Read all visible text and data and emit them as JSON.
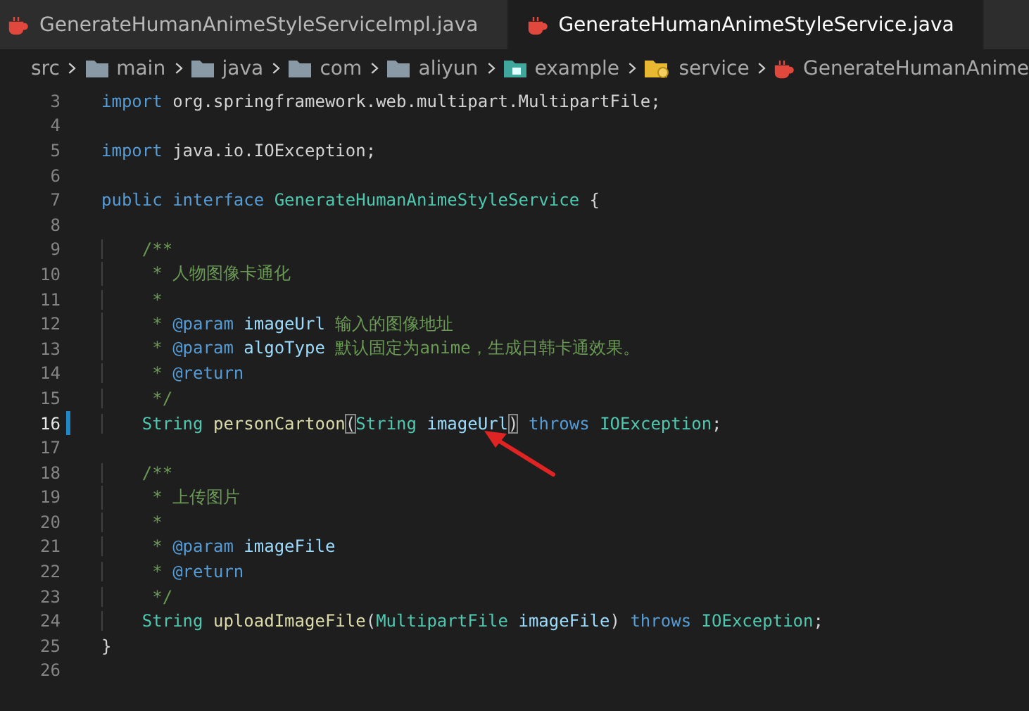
{
  "tabs": [
    {
      "label": "GenerateHumanAnimeStyleServiceImpl.java",
      "selected": false
    },
    {
      "label": "GenerateHumanAnimeStyleService.java",
      "selected": true
    }
  ],
  "breadcrumb": [
    {
      "kind": "text",
      "label": "src"
    },
    {
      "kind": "folder",
      "label": "main"
    },
    {
      "kind": "folder",
      "label": "java"
    },
    {
      "kind": "folder",
      "label": "com"
    },
    {
      "kind": "folder",
      "label": "aliyun"
    },
    {
      "kind": "package",
      "label": "example"
    },
    {
      "kind": "config-folder",
      "label": "service"
    },
    {
      "kind": "java-file",
      "label": "GenerateHumanAnime"
    }
  ],
  "lines": [
    {
      "n": "3",
      "current": false,
      "tokens": [
        {
          "kind": "keyword",
          "text": "import"
        },
        {
          "kind": "plain",
          "text": " org.springframework.web.multipart.MultipartFile;"
        }
      ]
    },
    {
      "n": "4",
      "current": false
    },
    {
      "n": "5",
      "current": false,
      "tokens": [
        {
          "kind": "keyword",
          "text": "import"
        },
        {
          "kind": "plain",
          "text": " java.io.IOException;"
        }
      ]
    },
    {
      "n": "6",
      "current": false
    },
    {
      "n": "7",
      "current": false,
      "tokens": [
        {
          "kind": "keyword",
          "text": "public interface"
        },
        {
          "kind": "type",
          "text": " GenerateHumanAnimeStyleService"
        },
        {
          "kind": "plain",
          "text": " {"
        }
      ]
    },
    {
      "n": "8",
      "current": false
    },
    {
      "n": "9",
      "current": false,
      "tokens": [
        {
          "kind": "comment",
          "text": "    /**"
        }
      ]
    },
    {
      "n": "10",
      "current": false,
      "tokens": [
        {
          "kind": "comment",
          "text": "     * 人物图像卡通化"
        }
      ]
    },
    {
      "n": "11",
      "current": false,
      "tokens": [
        {
          "kind": "comment",
          "text": "     *"
        }
      ]
    },
    {
      "n": "12",
      "current": false,
      "tokens": [
        {
          "kind": "comment",
          "text": "     * "
        },
        {
          "kind": "doc-tag",
          "text": "@param"
        },
        {
          "kind": "param",
          "text": " imageUrl"
        },
        {
          "kind": "comment",
          "text": " 输入的图像地址"
        }
      ]
    },
    {
      "n": "13",
      "current": false,
      "tokens": [
        {
          "kind": "comment",
          "text": "     * "
        },
        {
          "kind": "doc-tag",
          "text": "@param"
        },
        {
          "kind": "param",
          "text": " algoType"
        },
        {
          "kind": "comment",
          "text": " 默认固定为anime，生成日韩卡通效果。"
        }
      ]
    },
    {
      "n": "14",
      "current": false,
      "tokens": [
        {
          "kind": "comment",
          "text": "     * "
        },
        {
          "kind": "doc-tag",
          "text": "@return"
        }
      ]
    },
    {
      "n": "15",
      "current": false,
      "tokens": [
        {
          "kind": "comment",
          "text": "     */"
        }
      ]
    },
    {
      "n": "16",
      "current": true,
      "tokens": [
        {
          "kind": "type",
          "text": "    String"
        },
        {
          "kind": "method",
          "text": " personCartoon"
        },
        {
          "kind": "bracket-match",
          "text": "("
        },
        {
          "kind": "type",
          "text": "String"
        },
        {
          "kind": "param",
          "text": " imageUrl"
        },
        {
          "kind": "bracket-match",
          "text": ")"
        },
        {
          "kind": "keyword",
          "text": " throws"
        },
        {
          "kind": "type",
          "text": " IOException"
        },
        {
          "kind": "plain",
          "text": ";"
        }
      ]
    },
    {
      "n": "17",
      "current": false
    },
    {
      "n": "18",
      "current": false,
      "tokens": [
        {
          "kind": "comment",
          "text": "    /**"
        }
      ]
    },
    {
      "n": "19",
      "current": false,
      "tokens": [
        {
          "kind": "comment",
          "text": "     * 上传图片"
        }
      ]
    },
    {
      "n": "20",
      "current": false,
      "tokens": [
        {
          "kind": "comment",
          "text": "     *"
        }
      ]
    },
    {
      "n": "21",
      "current": false,
      "tokens": [
        {
          "kind": "comment",
          "text": "     * "
        },
        {
          "kind": "doc-tag",
          "text": "@param"
        },
        {
          "kind": "param",
          "text": " imageFile"
        }
      ]
    },
    {
      "n": "22",
      "current": false,
      "tokens": [
        {
          "kind": "comment",
          "text": "     * "
        },
        {
          "kind": "doc-tag",
          "text": "@return"
        }
      ]
    },
    {
      "n": "23",
      "current": false,
      "tokens": [
        {
          "kind": "comment",
          "text": "     */"
        }
      ]
    },
    {
      "n": "24",
      "current": false,
      "tokens": [
        {
          "kind": "type",
          "text": "    String"
        },
        {
          "kind": "method",
          "text": " uploadImageFile"
        },
        {
          "kind": "plain",
          "text": "("
        },
        {
          "kind": "type",
          "text": "MultipartFile"
        },
        {
          "kind": "param",
          "text": " imageFile"
        },
        {
          "kind": "plain",
          "text": ")"
        },
        {
          "kind": "keyword",
          "text": " throws"
        },
        {
          "kind": "type",
          "text": " IOException"
        },
        {
          "kind": "plain",
          "text": ";"
        }
      ]
    },
    {
      "n": "25",
      "current": false,
      "tokens": [
        {
          "kind": "plain",
          "text": "}"
        }
      ]
    },
    {
      "n": "26",
      "current": false
    }
  ]
}
